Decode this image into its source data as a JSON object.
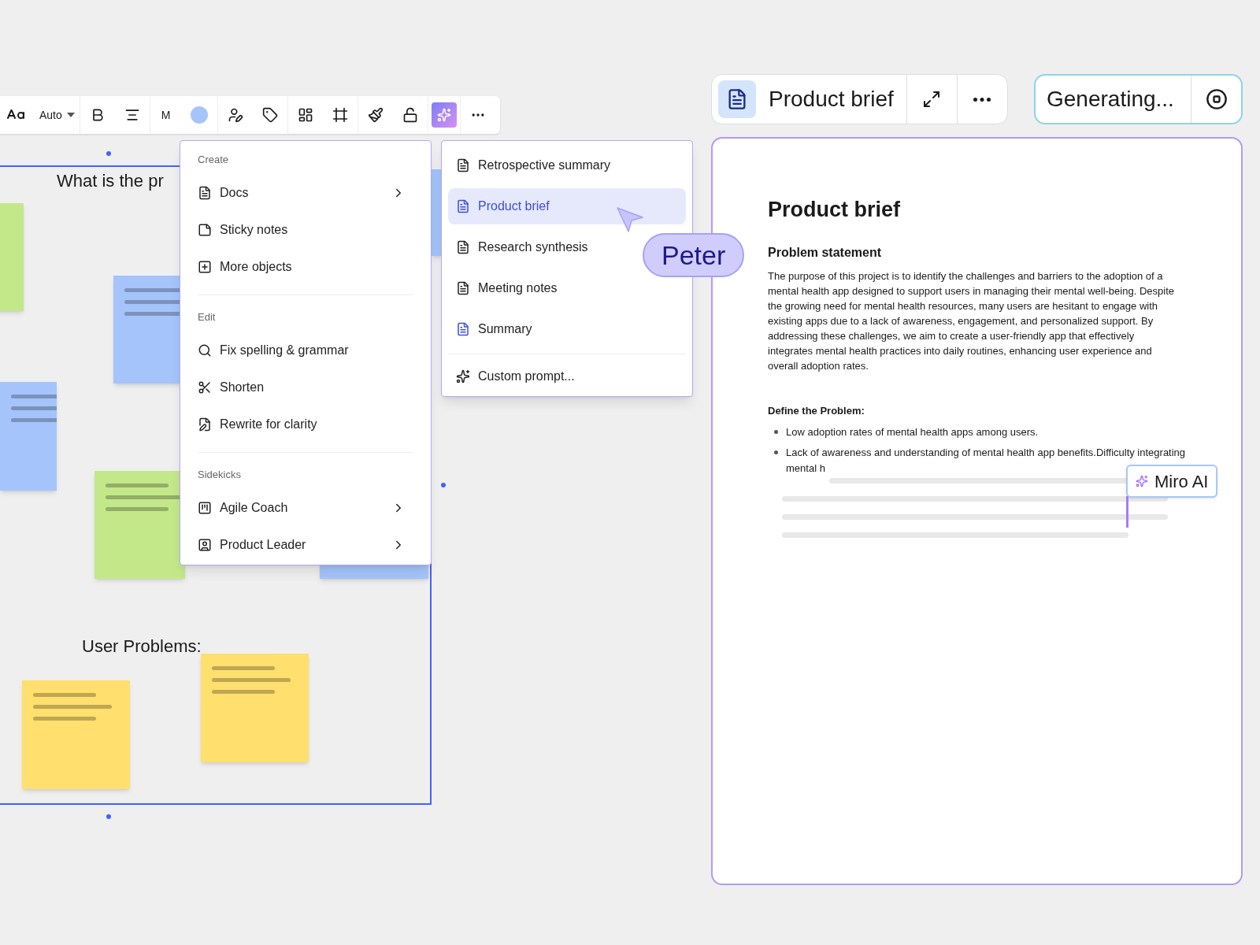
{
  "toolbar": {
    "font_size": "Auto",
    "size_label": "M"
  },
  "canvas": {
    "frame_title": "What is the pr",
    "section_title": "User Problems:",
    "stickies": [
      {
        "color": "#c3e88a"
      },
      {
        "color": "#a4c4fb"
      },
      {
        "color": "#a4c4fb"
      },
      {
        "color": "#c3e88a"
      },
      {
        "color": "#a4c4fb"
      },
      {
        "color": "#a4c4fb"
      },
      {
        "color": "#ffdf6e"
      },
      {
        "color": "#ffdf6e"
      }
    ]
  },
  "menu": {
    "sections": [
      {
        "title": "Create",
        "items": [
          {
            "label": "Docs",
            "kind": "doc",
            "submenu": true
          },
          {
            "label": "Sticky notes",
            "kind": "sticky",
            "submenu": false
          },
          {
            "label": "More objects",
            "kind": "objects",
            "submenu": false
          }
        ]
      },
      {
        "title": "Edit",
        "items": [
          {
            "label": "Fix spelling & grammar",
            "kind": "search",
            "submenu": false
          },
          {
            "label": "Shorten",
            "kind": "scissors",
            "submenu": false
          },
          {
            "label": "Rewrite for clarity",
            "kind": "rewrite",
            "submenu": false
          }
        ]
      },
      {
        "title": "Sidekicks",
        "items": [
          {
            "label": "Agile Coach",
            "kind": "board",
            "submenu": true
          },
          {
            "label": "Product Leader",
            "kind": "person",
            "submenu": true
          }
        ]
      }
    ]
  },
  "submenu": {
    "items": [
      {
        "label": "Retrospective summary",
        "selected": false
      },
      {
        "label": "Product brief",
        "selected": true
      },
      {
        "label": "Research synthesis",
        "selected": false
      },
      {
        "label": "Meeting notes",
        "selected": false
      },
      {
        "label": "Summary",
        "selected": false
      }
    ],
    "custom": "Custom prompt..."
  },
  "cursor": {
    "name": "Peter"
  },
  "doc_header": {
    "title": "Product brief"
  },
  "status": {
    "label": "Generating..."
  },
  "doc": {
    "title": "Product brief",
    "heading": "Problem statement",
    "paragraph": "The purpose of this project is to identify the challenges and barriers to the adoption of a mental health app designed to support users in managing their mental well-being. Despite the growing need for mental health resources, many users are hesitant to engage with existing apps due to a lack of awareness, engagement, and personalized support. By addressing these challenges, we aim to create a user-friendly app that effectively integrates mental health practices into daily routines, enhancing user experience and overall adoption rates.",
    "subheading": "Define the Problem:",
    "bullets": [
      "Low adoption rates of mental health apps among users.",
      "Lack of awareness and understanding of mental health app benefits.Difficulty integrating mental h"
    ],
    "ai_tag": "Miro AI"
  }
}
